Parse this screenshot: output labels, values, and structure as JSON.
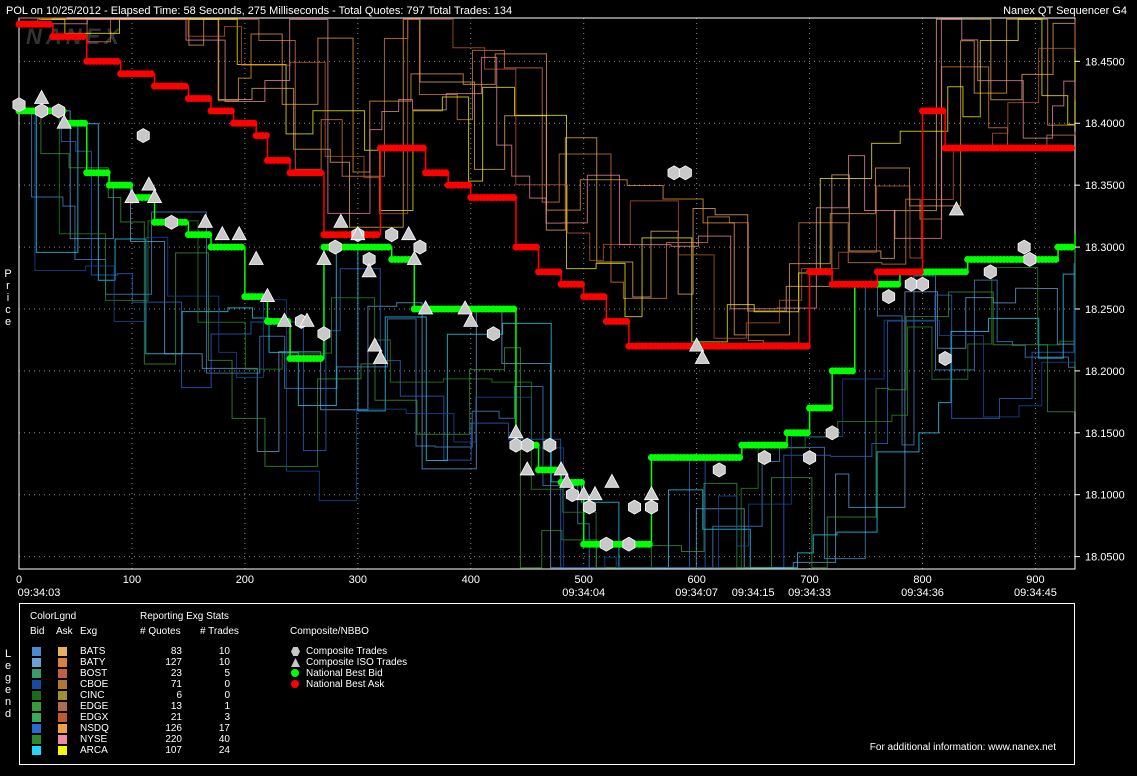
{
  "header": {
    "title": "POL on 10/25/2012  -  Elapsed Time: 58 Seconds, 275 Milliseconds  -  Total Quotes: 797  Total Trades: 134",
    "app_name": "Nanex QT Sequencer G4",
    "watermark": "NANEX"
  },
  "side_labels": {
    "price": "Price",
    "legend": "Legend"
  },
  "colors": {
    "bid": "#00ff00",
    "ask": "#ff0000",
    "trade": "#c8c8c8",
    "background": "#000000",
    "grid": "#ffffff"
  },
  "chart_data": {
    "type": "line",
    "xlabel": "",
    "ylabel": "Price",
    "xlim": [
      0,
      935
    ],
    "ylim": [
      18.04,
      18.485
    ],
    "grid": true,
    "y_ticks": [
      "18.4500",
      "18.4000",
      "18.3500",
      "18.3000",
      "18.2500",
      "18.2000",
      "18.1500",
      "18.1000",
      "18.0500"
    ],
    "y_tick_values": [
      18.45,
      18.4,
      18.35,
      18.3,
      18.25,
      18.2,
      18.15,
      18.1,
      18.05
    ],
    "x_ticks": [
      "0",
      "100",
      "200",
      "300",
      "400",
      "500",
      "600",
      "700",
      "800",
      "900"
    ],
    "x_tick_values": [
      0,
      100,
      200,
      300,
      400,
      500,
      600,
      700,
      800,
      900
    ],
    "time_labels": [
      {
        "x": 0,
        "label": "09:34:03"
      },
      {
        "x": 500,
        "label": "09:34:04"
      },
      {
        "x": 600,
        "label": "09:34:07"
      },
      {
        "x": 650,
        "label": "09:34:15"
      },
      {
        "x": 700,
        "label": "09:34:33"
      },
      {
        "x": 800,
        "label": "09:34:36"
      },
      {
        "x": 900,
        "label": "09:34:45"
      }
    ],
    "series": [
      {
        "name": "National Best Bid",
        "color": "#00ff00",
        "x": [
          0,
          30,
          40,
          60,
          80,
          100,
          120,
          150,
          170,
          200,
          220,
          240,
          270,
          300,
          330,
          350,
          380,
          420,
          440,
          460,
          480,
          500,
          520,
          540,
          560,
          580,
          600,
          620,
          640,
          660,
          680,
          700,
          720,
          740,
          760,
          780,
          800,
          820,
          840,
          860,
          880,
          900,
          920,
          935
        ],
        "y": [
          18.41,
          18.41,
          18.4,
          18.36,
          18.35,
          18.34,
          18.32,
          18.31,
          18.3,
          18.26,
          18.24,
          18.21,
          18.3,
          18.3,
          18.29,
          18.25,
          18.25,
          18.25,
          18.14,
          18.12,
          18.11,
          18.06,
          18.06,
          18.06,
          18.13,
          18.13,
          18.13,
          18.13,
          18.14,
          18.14,
          18.15,
          18.17,
          18.2,
          18.27,
          18.27,
          18.28,
          18.28,
          18.28,
          18.29,
          18.29,
          18.29,
          18.29,
          18.3,
          18.31
        ]
      },
      {
        "name": "National Best Ask",
        "color": "#ff0000",
        "x": [
          0,
          30,
          60,
          90,
          120,
          150,
          170,
          190,
          210,
          220,
          240,
          270,
          290,
          320,
          340,
          360,
          380,
          400,
          420,
          440,
          460,
          480,
          500,
          520,
          540,
          560,
          580,
          600,
          620,
          640,
          660,
          680,
          700,
          720,
          740,
          760,
          780,
          800,
          820,
          840,
          860,
          880,
          900,
          920,
          935
        ],
        "y": [
          18.48,
          18.47,
          18.45,
          18.44,
          18.43,
          18.42,
          18.41,
          18.4,
          18.39,
          18.37,
          18.36,
          18.31,
          18.31,
          18.38,
          18.38,
          18.36,
          18.35,
          18.34,
          18.34,
          18.3,
          18.28,
          18.27,
          18.26,
          18.24,
          18.22,
          18.22,
          18.22,
          18.22,
          18.22,
          18.22,
          18.22,
          18.22,
          18.28,
          18.27,
          18.27,
          18.28,
          18.28,
          18.41,
          18.38,
          18.38,
          18.38,
          18.38,
          18.38,
          18.38,
          18.38
        ]
      }
    ],
    "composite_trades": [
      {
        "x": 0,
        "y": 18.415
      },
      {
        "x": 20,
        "y": 18.41
      },
      {
        "x": 35,
        "y": 18.41
      },
      {
        "x": 110,
        "y": 18.39
      },
      {
        "x": 135,
        "y": 18.32
      },
      {
        "x": 250,
        "y": 18.24
      },
      {
        "x": 270,
        "y": 18.23
      },
      {
        "x": 280,
        "y": 18.3
      },
      {
        "x": 300,
        "y": 18.31
      },
      {
        "x": 310,
        "y": 18.29
      },
      {
        "x": 330,
        "y": 18.31
      },
      {
        "x": 355,
        "y": 18.3
      },
      {
        "x": 420,
        "y": 18.23
      },
      {
        "x": 440,
        "y": 18.14
      },
      {
        "x": 450,
        "y": 18.14
      },
      {
        "x": 470,
        "y": 18.14
      },
      {
        "x": 490,
        "y": 18.1
      },
      {
        "x": 505,
        "y": 18.09
      },
      {
        "x": 520,
        "y": 18.06
      },
      {
        "x": 540,
        "y": 18.06
      },
      {
        "x": 545,
        "y": 18.09
      },
      {
        "x": 560,
        "y": 18.09
      },
      {
        "x": 580,
        "y": 18.36
      },
      {
        "x": 590,
        "y": 18.36
      },
      {
        "x": 620,
        "y": 18.12
      },
      {
        "x": 660,
        "y": 18.13
      },
      {
        "x": 700,
        "y": 18.13
      },
      {
        "x": 720,
        "y": 18.15
      },
      {
        "x": 770,
        "y": 18.26
      },
      {
        "x": 790,
        "y": 18.27
      },
      {
        "x": 800,
        "y": 18.27
      },
      {
        "x": 820,
        "y": 18.21
      },
      {
        "x": 860,
        "y": 18.28
      },
      {
        "x": 890,
        "y": 18.3
      },
      {
        "x": 895,
        "y": 18.29
      }
    ],
    "composite_iso_trades": [
      {
        "x": 20,
        "y": 18.42
      },
      {
        "x": 40,
        "y": 18.4
      },
      {
        "x": 100,
        "y": 18.34
      },
      {
        "x": 115,
        "y": 18.35
      },
      {
        "x": 120,
        "y": 18.34
      },
      {
        "x": 165,
        "y": 18.32
      },
      {
        "x": 180,
        "y": 18.31
      },
      {
        "x": 195,
        "y": 18.31
      },
      {
        "x": 210,
        "y": 18.29
      },
      {
        "x": 220,
        "y": 18.26
      },
      {
        "x": 235,
        "y": 18.24
      },
      {
        "x": 255,
        "y": 18.24
      },
      {
        "x": 270,
        "y": 18.29
      },
      {
        "x": 285,
        "y": 18.32
      },
      {
        "x": 300,
        "y": 18.31
      },
      {
        "x": 310,
        "y": 18.28
      },
      {
        "x": 315,
        "y": 18.22
      },
      {
        "x": 320,
        "y": 18.21
      },
      {
        "x": 345,
        "y": 18.31
      },
      {
        "x": 350,
        "y": 18.29
      },
      {
        "x": 360,
        "y": 18.25
      },
      {
        "x": 395,
        "y": 18.25
      },
      {
        "x": 400,
        "y": 18.24
      },
      {
        "x": 440,
        "y": 18.15
      },
      {
        "x": 450,
        "y": 18.12
      },
      {
        "x": 480,
        "y": 18.12
      },
      {
        "x": 485,
        "y": 18.11
      },
      {
        "x": 500,
        "y": 18.1
      },
      {
        "x": 510,
        "y": 18.1
      },
      {
        "x": 525,
        "y": 18.11
      },
      {
        "x": 560,
        "y": 18.1
      },
      {
        "x": 600,
        "y": 18.22
      },
      {
        "x": 605,
        "y": 18.21
      },
      {
        "x": 830,
        "y": 18.33
      }
    ]
  },
  "legend": {
    "color_legend_title": "ColorLgnd",
    "stats_title": "Reporting Exg Stats",
    "col_bid": "Bid",
    "col_ask": "Ask",
    "col_exg": "Exg",
    "col_quotes": "# Quotes",
    "col_trades": "# Trades",
    "exchanges": [
      {
        "exg": "BATS",
        "quotes": "83",
        "trades": "10",
        "bid_color": "#4a8acd",
        "ask_color": "#e8b060"
      },
      {
        "exg": "BATY",
        "quotes": "127",
        "trades": "10",
        "bid_color": "#6ba0d8",
        "ask_color": "#d88040"
      },
      {
        "exg": "BOST",
        "quotes": "23",
        "trades": "5",
        "bid_color": "#3a9a6a",
        "ask_color": "#c06040"
      },
      {
        "exg": "CBOE",
        "quotes": "71",
        "trades": "0",
        "bid_color": "#1a4aa0",
        "ask_color": "#b07830"
      },
      {
        "exg": "CINC",
        "quotes": "6",
        "trades": "0",
        "bid_color": "#1a6a1a",
        "ask_color": "#a09030"
      },
      {
        "exg": "EDGE",
        "quotes": "13",
        "trades": "1",
        "bid_color": "#3a9a3a",
        "ask_color": "#b06a50"
      },
      {
        "exg": "EDGX",
        "quotes": "21",
        "trades": "3",
        "bid_color": "#3aaa5a",
        "ask_color": "#c05a30"
      },
      {
        "exg": "NSDQ",
        "quotes": "126",
        "trades": "17",
        "bid_color": "#2a6ad0",
        "ask_color": "#f0a040"
      },
      {
        "exg": "NYSE",
        "quotes": "220",
        "trades": "40",
        "bid_color": "#2a8a2a",
        "ask_color": "#f08aa0"
      },
      {
        "exg": "ARCA",
        "quotes": "107",
        "trades": "24",
        "bid_color": "#20d8ff",
        "ask_color": "#f8f800"
      }
    ],
    "composite_title": "Composite/NBBO",
    "composite_items": [
      {
        "label": "Composite Trades",
        "icon": "hexagon-icon"
      },
      {
        "label": "Composite ISO Trades",
        "icon": "triangle-icon"
      },
      {
        "label": "National Best Bid",
        "icon": "green-dot-icon"
      },
      {
        "label": "National Best Ask",
        "icon": "red-dot-icon"
      }
    ],
    "footer": "For additional information: www.nanex.net"
  }
}
